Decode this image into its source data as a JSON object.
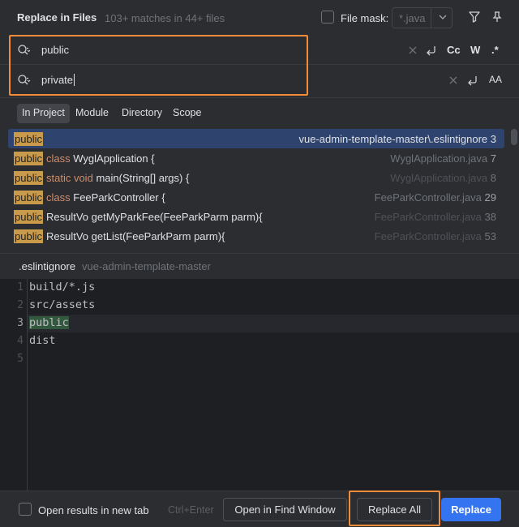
{
  "header": {
    "title": "Replace in Files",
    "matches": "103+ matches in 44+ files",
    "file_mask_label": "File mask:",
    "file_mask_value": "*.java"
  },
  "find": {
    "search_value": "public",
    "replace_value": "private",
    "case_label": "Cc",
    "word_label": "W",
    "regex_label": ".*",
    "preserve_case_label": "AA"
  },
  "scopes": [
    {
      "label": "In Project",
      "active": true
    },
    {
      "label": "Module",
      "active": false
    },
    {
      "label": "Directory",
      "active": false
    },
    {
      "label": "Scope",
      "active": false
    }
  ],
  "results": [
    {
      "keyword": "public",
      "rest": "",
      "rest_keyword": "",
      "file": "vue-admin-template-master\\.eslintignore",
      "line": "3"
    },
    {
      "keyword": "public",
      "rest_keyword": "class",
      "rest": "WyglApplication {",
      "file": "WyglApplication.java",
      "line": "7"
    },
    {
      "keyword": "public",
      "rest_keyword": "static void",
      "rest": "main(String[] args) {",
      "file": "WyglApplication.java",
      "line": "8"
    },
    {
      "keyword": "public",
      "rest_keyword": "class",
      "rest": "FeeParkController {",
      "file": "FeeParkController.java",
      "line": "29"
    },
    {
      "keyword": "public",
      "rest_keyword": "",
      "rest": "ResultVo getMyParkFee(FeeParkParm parm){",
      "file": "FeeParkController.java",
      "line": "38"
    },
    {
      "keyword": "public",
      "rest_keyword": "",
      "rest": "ResultVo getList(FeeParkParm parm){",
      "file": "FeeParkController.java",
      "line": "53"
    }
  ],
  "preview": {
    "file_name": ".eslintignore",
    "path": "vue-admin-template-master",
    "lines": [
      "build/*.js",
      "src/assets",
      "public",
      "dist",
      ""
    ],
    "line_numbers": [
      "1",
      "2",
      "3",
      "4",
      "5"
    ]
  },
  "footer": {
    "open_tab_label": "Open results in new tab",
    "shortcut": "Ctrl+Enter",
    "open_find_window": "Open in Find Window",
    "replace_all": "Replace All",
    "replace": "Replace"
  },
  "colors": {
    "accent": "#3574f0",
    "highlight_box": "#f28c38",
    "match_badge": "#c99a4a"
  },
  "icons": [
    "search-icon",
    "filter-icon",
    "pin-icon",
    "clear-icon",
    "newline-icon",
    "chevron-down-icon"
  ]
}
